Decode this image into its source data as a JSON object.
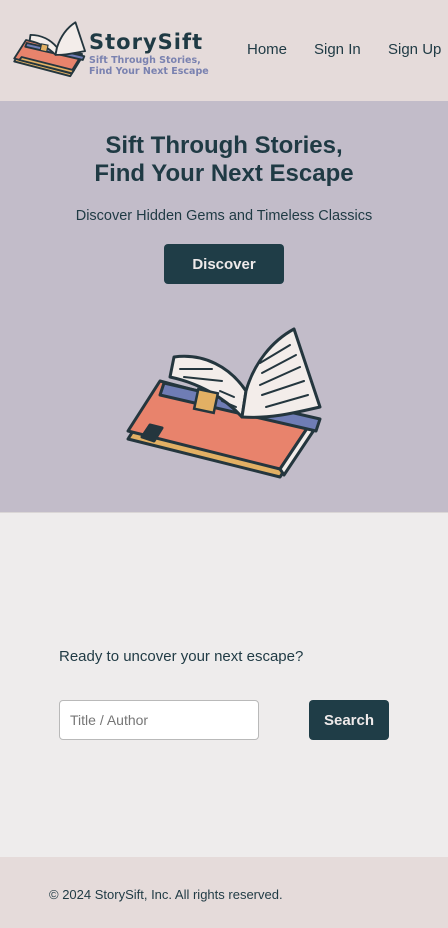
{
  "header": {
    "brand_name": "StorySift",
    "brand_tagline": "Sift Through Stories, Find Your Next Escape",
    "nav": {
      "home": "Home",
      "sign_in": "Sign In",
      "sign_up": "Sign Up"
    }
  },
  "hero": {
    "title_line1": "Sift Through Stories,",
    "title_line2": "Find Your Next Escape",
    "subtitle": "Discover Hidden Gems and Timeless Classics",
    "cta_label": "Discover",
    "illustration_icon": "open-book-on-stack-icon"
  },
  "search": {
    "prompt": "Ready to uncover your next escape?",
    "placeholder": "Title / Author",
    "value": "",
    "button_label": "Search"
  },
  "footer": {
    "copyright": "© 2024 StorySift, Inc. All rights reserved."
  },
  "colors": {
    "header_bg": "#e5dbda",
    "hero_bg": "#c2bcc9",
    "primary": "#1f3d47",
    "text": "#1f3a44",
    "accent_blue": "#7a82b0",
    "book_coral": "#e8836c",
    "book_mustard": "#e2b064"
  }
}
